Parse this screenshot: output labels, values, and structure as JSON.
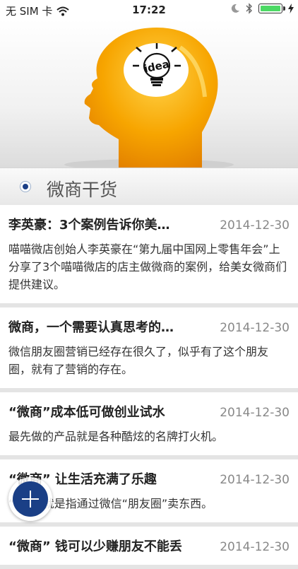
{
  "status": {
    "carrier": "无 SIM 卡",
    "time": "17:22",
    "battery_level": 1.0
  },
  "section": {
    "title": "微商干货"
  },
  "articles": [
    {
      "title": "李英豪：3个案例告诉你美…",
      "date": "2014-12-30",
      "summary": "喵喵微店创始人李英豪在“第九届中国网上零售年会”上分享了3个喵喵微店的店主做微商的案例，给美女微商们提供建议。"
    },
    {
      "title": "微商，一个需要认真思考的…",
      "date": "2014-12-30",
      "summary": "微信朋友圈营销已经存在很久了，似乎有了这个朋友圈，就有了营销的存在。"
    },
    {
      "title": "“微商”成本低可做创业试水",
      "date": "2014-12-30",
      "summary": "最先做的产品就是各种酷炫的名牌打火机。"
    },
    {
      "title": "“微商” 让生活充满了乐趣",
      "date": "2014-12-30",
      "summary": "“微商”就是指通过微信“朋友圈”卖东西。"
    },
    {
      "title": "“微商” 钱可以少赚朋友不能丢",
      "date": "2014-12-30",
      "summary": ""
    }
  ],
  "banner": {
    "bulb_text": "idea"
  },
  "icons": {
    "wifi": "wifi-icon",
    "moon": "moon-icon",
    "bluetooth": "bluetooth-icon",
    "charging": "charging-bolt-icon",
    "add": "plus-icon"
  },
  "colors": {
    "accent": "#1a3f86",
    "battery": "#4cd964",
    "head": "#f5a300"
  }
}
